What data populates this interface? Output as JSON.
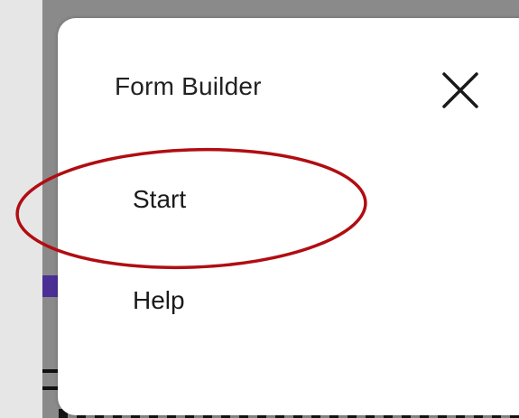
{
  "menu": {
    "title": "Form Builder",
    "close_icon": "close-icon",
    "items": [
      {
        "label": "Start"
      },
      {
        "label": "Help"
      }
    ]
  },
  "annotation": {
    "type": "ellipse-highlight",
    "target": "Start",
    "color": "#b00d12"
  },
  "colors": {
    "panel_background": "#ffffff",
    "backdrop": "#8a8a8a",
    "page_background": "#e6e6e6",
    "accent_purple": "#4b2f95",
    "text": "#1a1a1a"
  }
}
